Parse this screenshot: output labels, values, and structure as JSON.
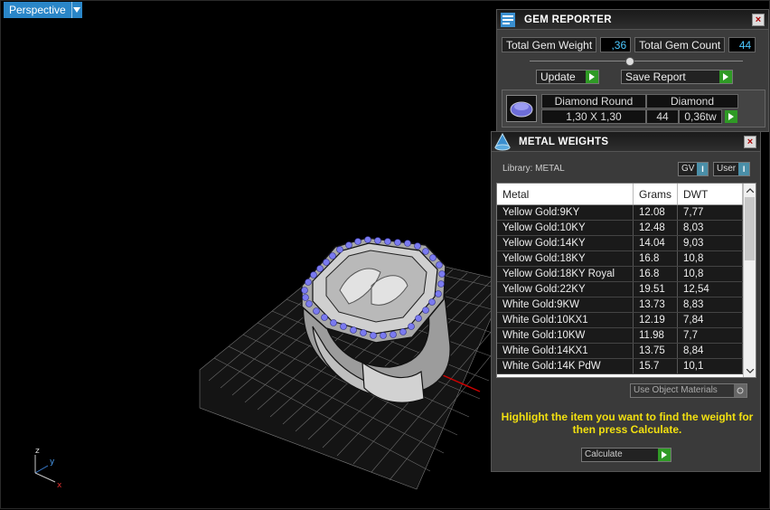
{
  "viewport": {
    "view_name": "Perspective"
  },
  "axis": {
    "x": "x",
    "y": "y",
    "z": "z"
  },
  "gem_reporter": {
    "title": "GEM REPORTER",
    "total_weight_label": "Total Gem Weight",
    "total_weight_value": ",36",
    "total_count_label": "Total Gem Count",
    "total_count_value": "44",
    "update_label": "Update",
    "save_report_label": "Save Report",
    "table": {
      "header": [
        "Diamond Round",
        "Diamond"
      ],
      "row": {
        "size": "1,30 X 1,30",
        "count": "44",
        "weight": "0,36tw"
      }
    }
  },
  "metal_weights": {
    "title": "METAL WEIGHTS",
    "library_label": "Library: METAL",
    "gv_label": "GV",
    "user_label": "User",
    "columns": [
      "Metal",
      "Grams",
      "DWT"
    ],
    "rows": [
      [
        "Yellow Gold:9KY",
        "12.08",
        "7,77"
      ],
      [
        "Yellow Gold:10KY",
        "12.48",
        "8,03"
      ],
      [
        "Yellow Gold:14KY",
        "14.04",
        "9,03"
      ],
      [
        "Yellow Gold:18KY",
        "16.8",
        "10,8"
      ],
      [
        "Yellow Gold:18KY Royal",
        "16.8",
        "10,8"
      ],
      [
        "Yellow Gold:22KY",
        "19.51",
        "12,54"
      ],
      [
        "White Gold:9KW",
        "13.73",
        "8,83"
      ],
      [
        "White Gold:10KX1",
        "12.19",
        "7,84"
      ],
      [
        "White Gold:10KW",
        "11.98",
        "7,7"
      ],
      [
        "White Gold:14KX1",
        "13.75",
        "8,84"
      ],
      [
        "White Gold:14K PdW",
        "15.7",
        "10,1"
      ]
    ],
    "use_object_materials_label": "Use Object Materials",
    "hint": "Highlight the item you want to find the weight for then press Calculate.",
    "calculate_label": "Calculate"
  }
}
